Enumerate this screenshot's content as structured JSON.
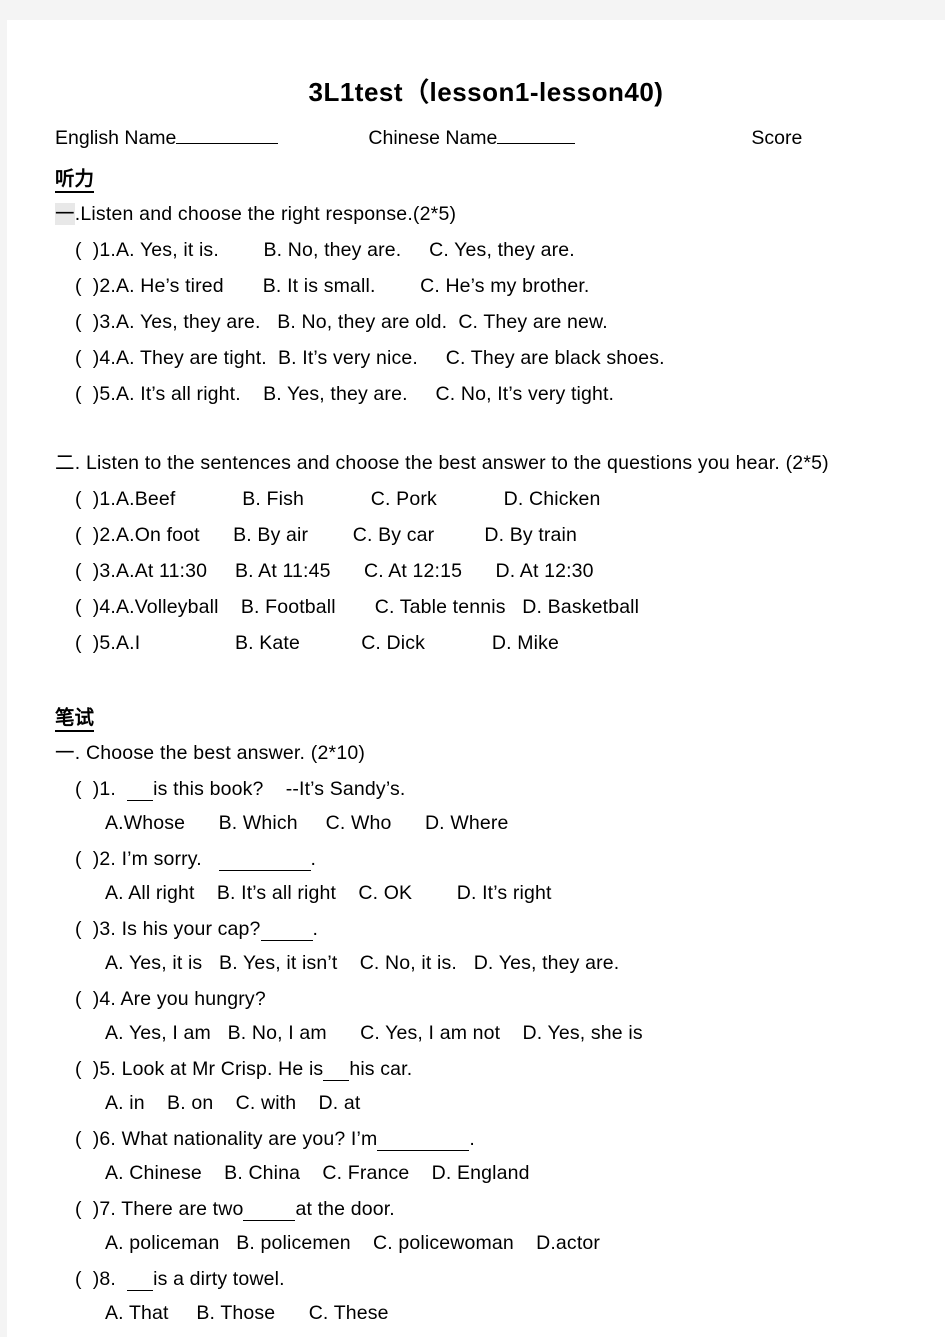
{
  "document": {
    "title": "3L1test（lesson1-lesson40)",
    "header": {
      "english_name_label": "English Name",
      "chinese_name_label": "Chinese Name",
      "score_label": "Score"
    },
    "sections": [
      {
        "id": "listening",
        "heading": "听力",
        "parts": [
          {
            "number": "一",
            "instruction": ".Listen and choose the right response.(2*5)",
            "questions": [
              {
                "marker": "(  )1.",
                "options": "A. Yes, it is.        B. No, they are.     C. Yes, they are."
              },
              {
                "marker": "(  )2.",
                "options": "A. He’s tired       B. It is small.        C. He’s my brother."
              },
              {
                "marker": "(  )3.",
                "options": "A. Yes, they are.   B. No, they are old.  C. They are new."
              },
              {
                "marker": "(  )4.",
                "options": "A. They are tight.  B. It’s very nice.     C. They are black shoes."
              },
              {
                "marker": "(  )5.",
                "options": "A. It’s all right.    B. Yes, they are.     C. No, It’s very tight."
              }
            ]
          },
          {
            "number": "二",
            "instruction": ". Listen to the sentences and choose the best answer to the questions you hear. (2*5)",
            "questions": [
              {
                "marker": "(  )1.",
                "options": "A.Beef            B. Fish            C. Pork            D. Chicken"
              },
              {
                "marker": "(  )2.",
                "options": "A.On foot      B. By air        C. By car         D. By train"
              },
              {
                "marker": "(  )3.",
                "options": "A.At 11:30     B. At 11:45      C. At 12:15      D. At 12:30"
              },
              {
                "marker": "(  )4.",
                "options": "A.Volleyball    B. Football       C. Table tennis   D. Basketball"
              },
              {
                "marker": "(  )5.",
                "options": "A.I                 B. Kate           C. Dick            D. Mike"
              }
            ]
          }
        ]
      },
      {
        "id": "written",
        "heading": "笔试",
        "parts": [
          {
            "number": "一",
            "instruction": ". Choose the best answer. (2*10)",
            "questions": [
              {
                "marker": "(  )1.",
                "stem_before": "  ",
                "blank": "sm",
                "stem_after": "is this book?    --It’s Sandy’s.",
                "options": "A.Whose      B. Which     C. Who      D. Where"
              },
              {
                "marker": "(  )2.",
                "stem_before": " I’m sorry.   ",
                "blank": "xl",
                "stem_after": ".",
                "options": "A. All right    B. It’s all right    C. OK        D. It’s right"
              },
              {
                "marker": "(  )3.",
                "stem_before": " Is his your cap?",
                "blank": "md",
                "stem_after": ".",
                "options": "A. Yes, it is   B. Yes, it isn’t    C. No, it is.   D. Yes, they are."
              },
              {
                "marker": "(  )4.",
                "stem_before": " Are you hungry?",
                "blank": "",
                "stem_after": "",
                "options": "A. Yes, I am   B. No, I am      C. Yes, I am not    D. Yes, she is"
              },
              {
                "marker": "(  )5.",
                "stem_before": " Look at Mr Crisp. He is",
                "blank": "sm",
                "stem_after": "his car.",
                "options": "A. in    B. on    C. with    D. at"
              },
              {
                "marker": "(  )6.",
                "stem_before": " What nationality are you? I’m",
                "blank": "xl",
                "stem_after": ".",
                "options": "A. Chinese    B. China    C. France    D. England"
              },
              {
                "marker": "(  )7.",
                "stem_before": " There are two",
                "blank": "md",
                "stem_after": "at the door.",
                "options": "A. policeman   B. policemen    C. policewoman    D.actor"
              },
              {
                "marker": "(  )8.",
                "stem_before": "  ",
                "blank": "sm",
                "stem_after": "is a dirty towel.",
                "options": "A. That     B. Those      C. These"
              }
            ]
          }
        ]
      }
    ]
  }
}
